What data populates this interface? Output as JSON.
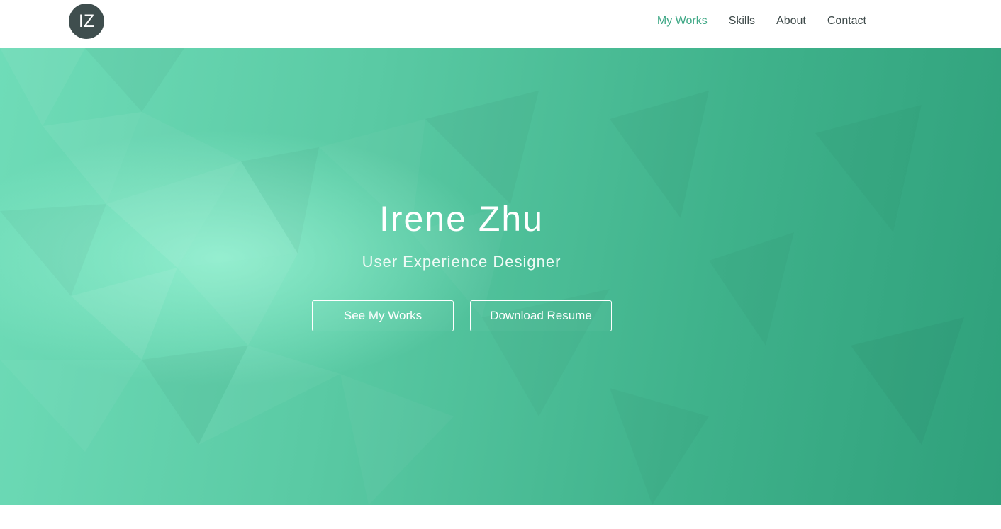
{
  "header": {
    "logo_text": "IZ",
    "nav": [
      {
        "label": "My Works",
        "active": true
      },
      {
        "label": "Skills",
        "active": false
      },
      {
        "label": "About",
        "active": false
      },
      {
        "label": "Contact",
        "active": false
      }
    ]
  },
  "hero": {
    "title": "Irene Zhu",
    "subtitle": "User Experience Designer",
    "buttons": {
      "works": "See My Works",
      "resume": "Download Resume"
    }
  },
  "colors": {
    "accent": "#3fa886",
    "logo_bg": "#3f4e4e",
    "hero_light": "#6fdcb8",
    "hero_dark": "#2fa07b"
  }
}
